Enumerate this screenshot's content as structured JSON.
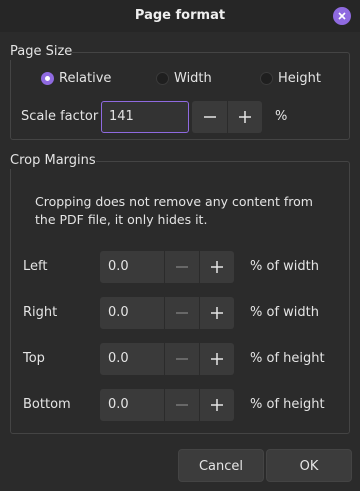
{
  "window": {
    "title": "Page format"
  },
  "page_size": {
    "title": "Page Size",
    "options": [
      "Relative",
      "Width",
      "Height"
    ],
    "selected": "Relative",
    "scale_label": "Scale factor",
    "scale_value": "141",
    "scale_unit": "%"
  },
  "crop": {
    "title": "Crop Margins",
    "note": "Cropping does not remove any content from the PDF file, it only hides it.",
    "rows": [
      {
        "label": "Left",
        "value": "0.0",
        "unit": "% of width"
      },
      {
        "label": "Right",
        "value": "0.0",
        "unit": "% of width"
      },
      {
        "label": "Top",
        "value": "0.0",
        "unit": "% of height"
      },
      {
        "label": "Bottom",
        "value": "0.0",
        "unit": "% of height"
      }
    ]
  },
  "buttons": {
    "cancel": "Cancel",
    "ok": "OK"
  },
  "colors": {
    "accent": "#8f6ae0",
    "background": "#2b2b2b",
    "control": "#3a3a3a"
  }
}
